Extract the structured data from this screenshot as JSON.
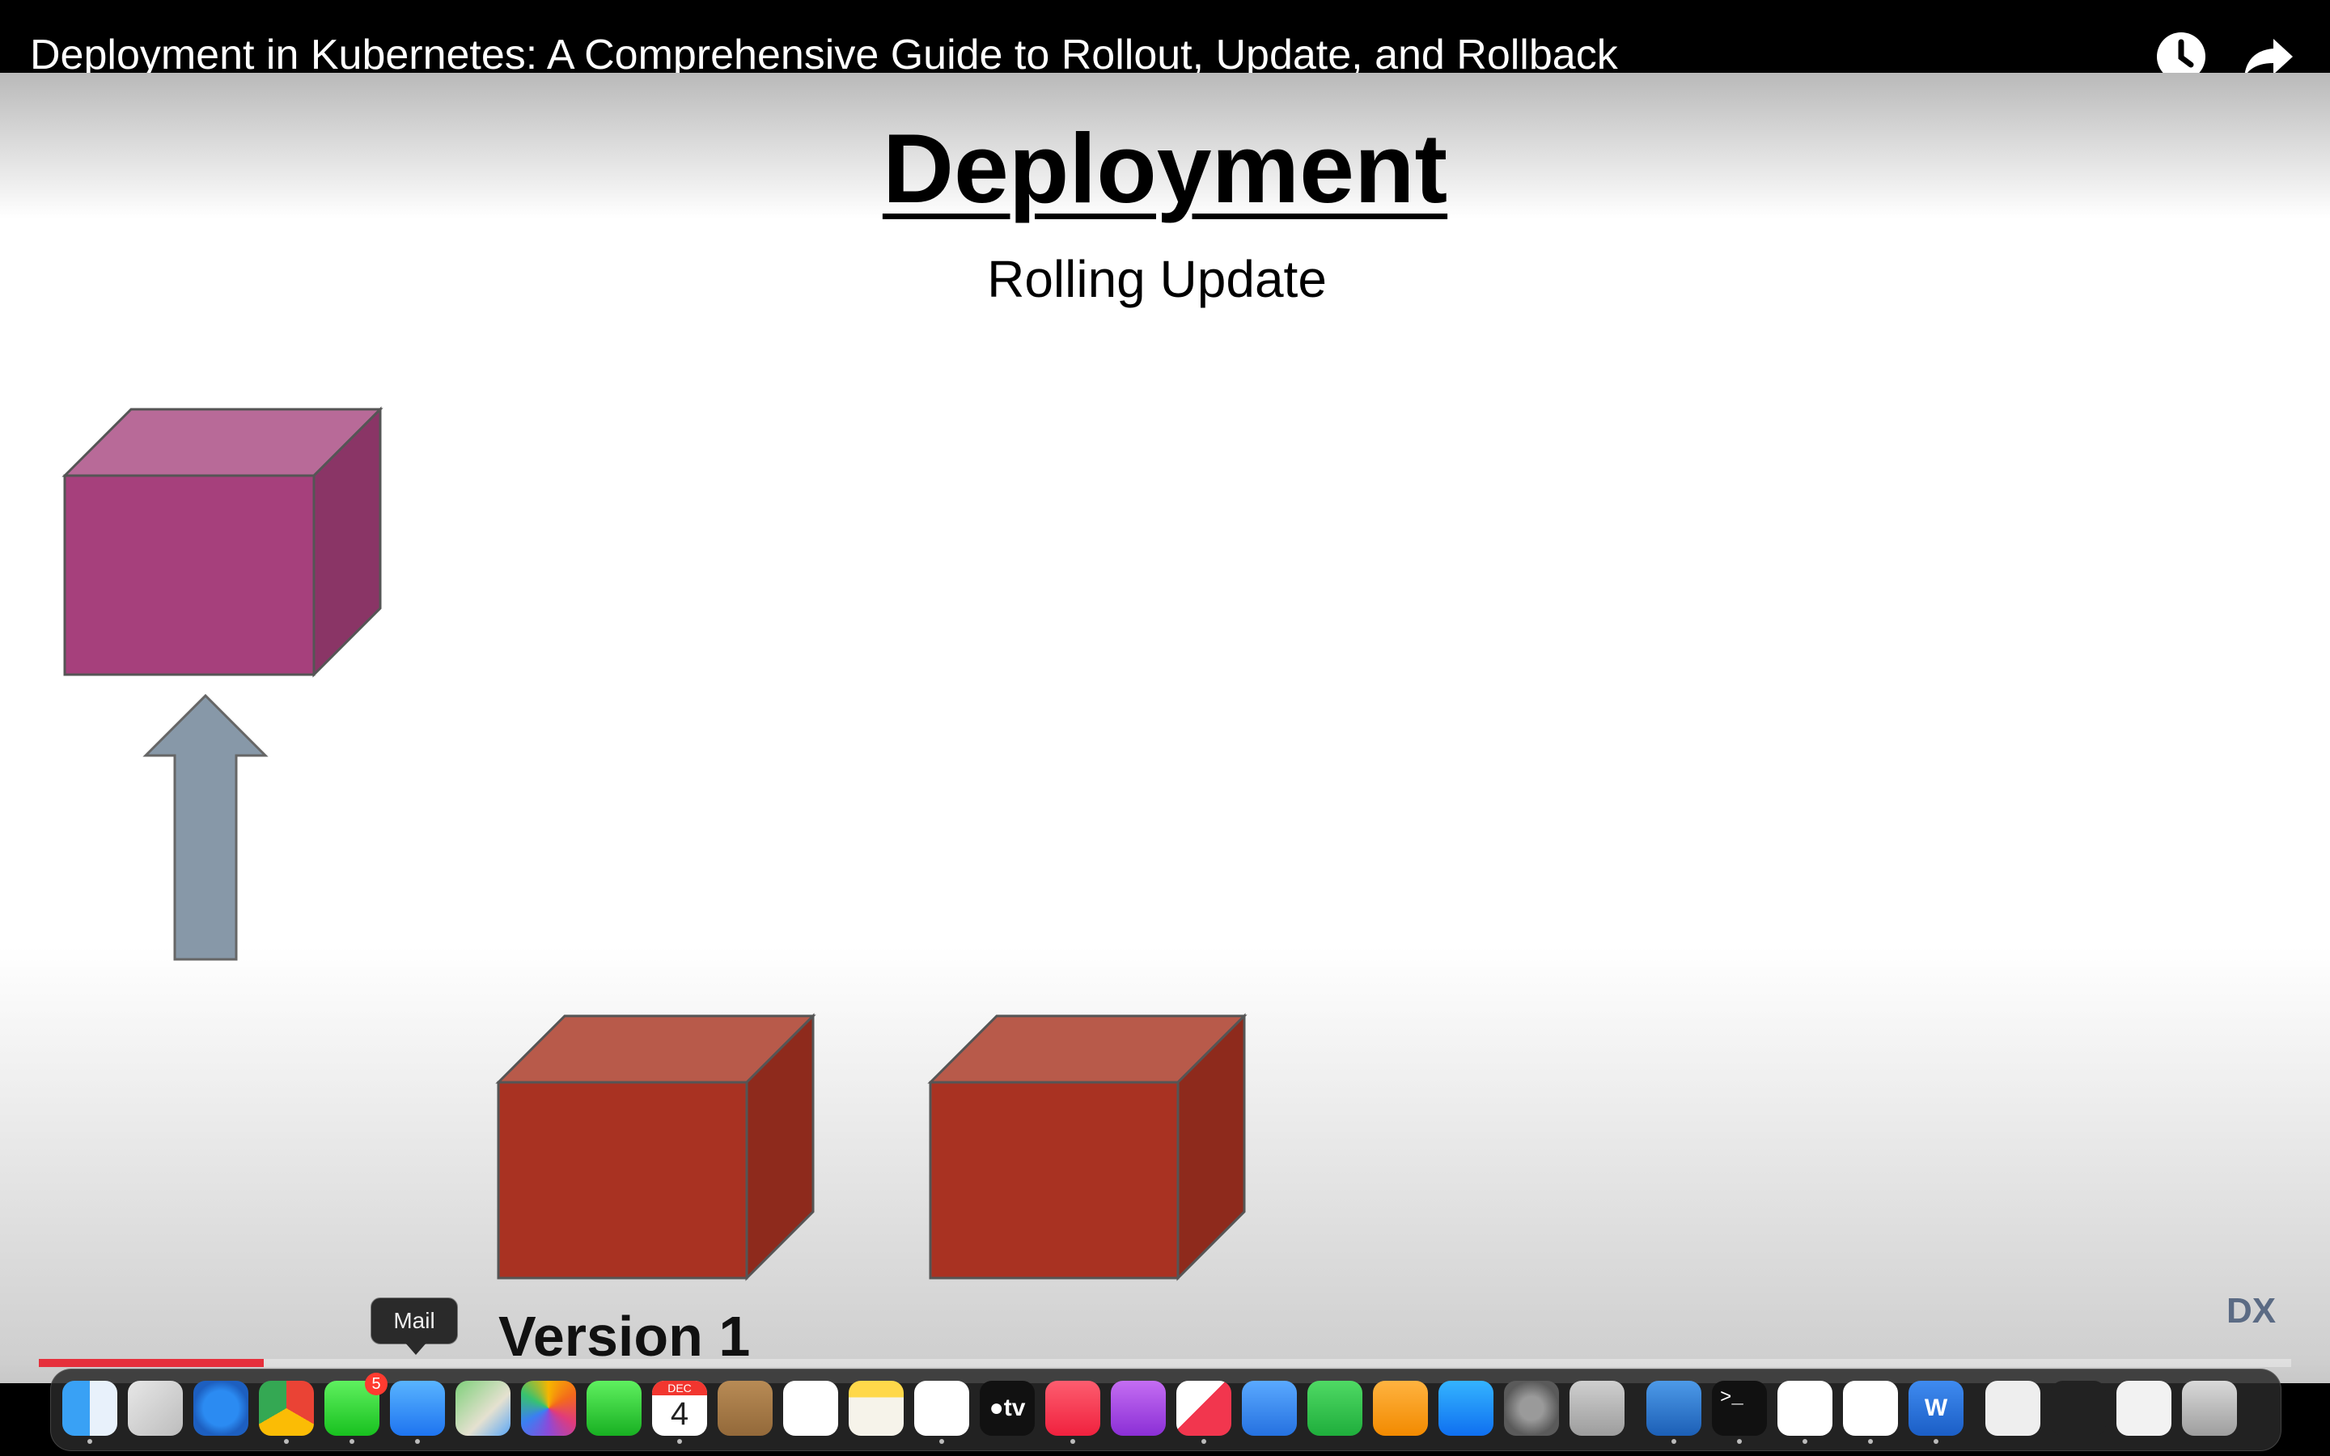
{
  "video": {
    "title": "Deployment in Kubernetes: A Comprehensive Guide to Rollout, Update, and Rollback",
    "progress_fraction": 0.1
  },
  "slide": {
    "title": "Deployment",
    "subtitle": "Rolling Update",
    "version_label": "Version 1",
    "watermark": "DX",
    "colors": {
      "new_pod_front": "#a6407c",
      "new_pod_top": "#b86a98",
      "new_pod_side": "#8a3566",
      "old_pod_front": "#a93222",
      "old_pod_top": "#b85a4a",
      "old_pod_side": "#8e2a1c",
      "arrow": "#8798a8"
    }
  },
  "dock": {
    "tooltip": "Mail",
    "messages_badge": "5",
    "calendar_month": "DEC",
    "calendar_day": "4",
    "tv_label": "tv",
    "apps": [
      "finder-icon",
      "launchpad-icon",
      "safari-icon",
      "chrome-icon",
      "messages-icon",
      "mail-icon",
      "maps-icon",
      "photos-icon",
      "facetime-icon",
      "calendar-icon",
      "contacts-icon",
      "reminders-icon",
      "notes-icon",
      "freeform-icon",
      "tv-icon",
      "music-icon",
      "podcasts-icon",
      "news-icon",
      "keynote-icon",
      "numbers-icon",
      "pages-icon",
      "app-store-icon",
      "system-settings-icon",
      "iphone-mirroring-icon",
      "openoffice-icon",
      "terminal-icon",
      "vscode-icon",
      "nordvpn-icon",
      "word-icon",
      "document-icon",
      "music-player-window-icon",
      "chrome-window-icon",
      "trash-icon"
    ]
  }
}
